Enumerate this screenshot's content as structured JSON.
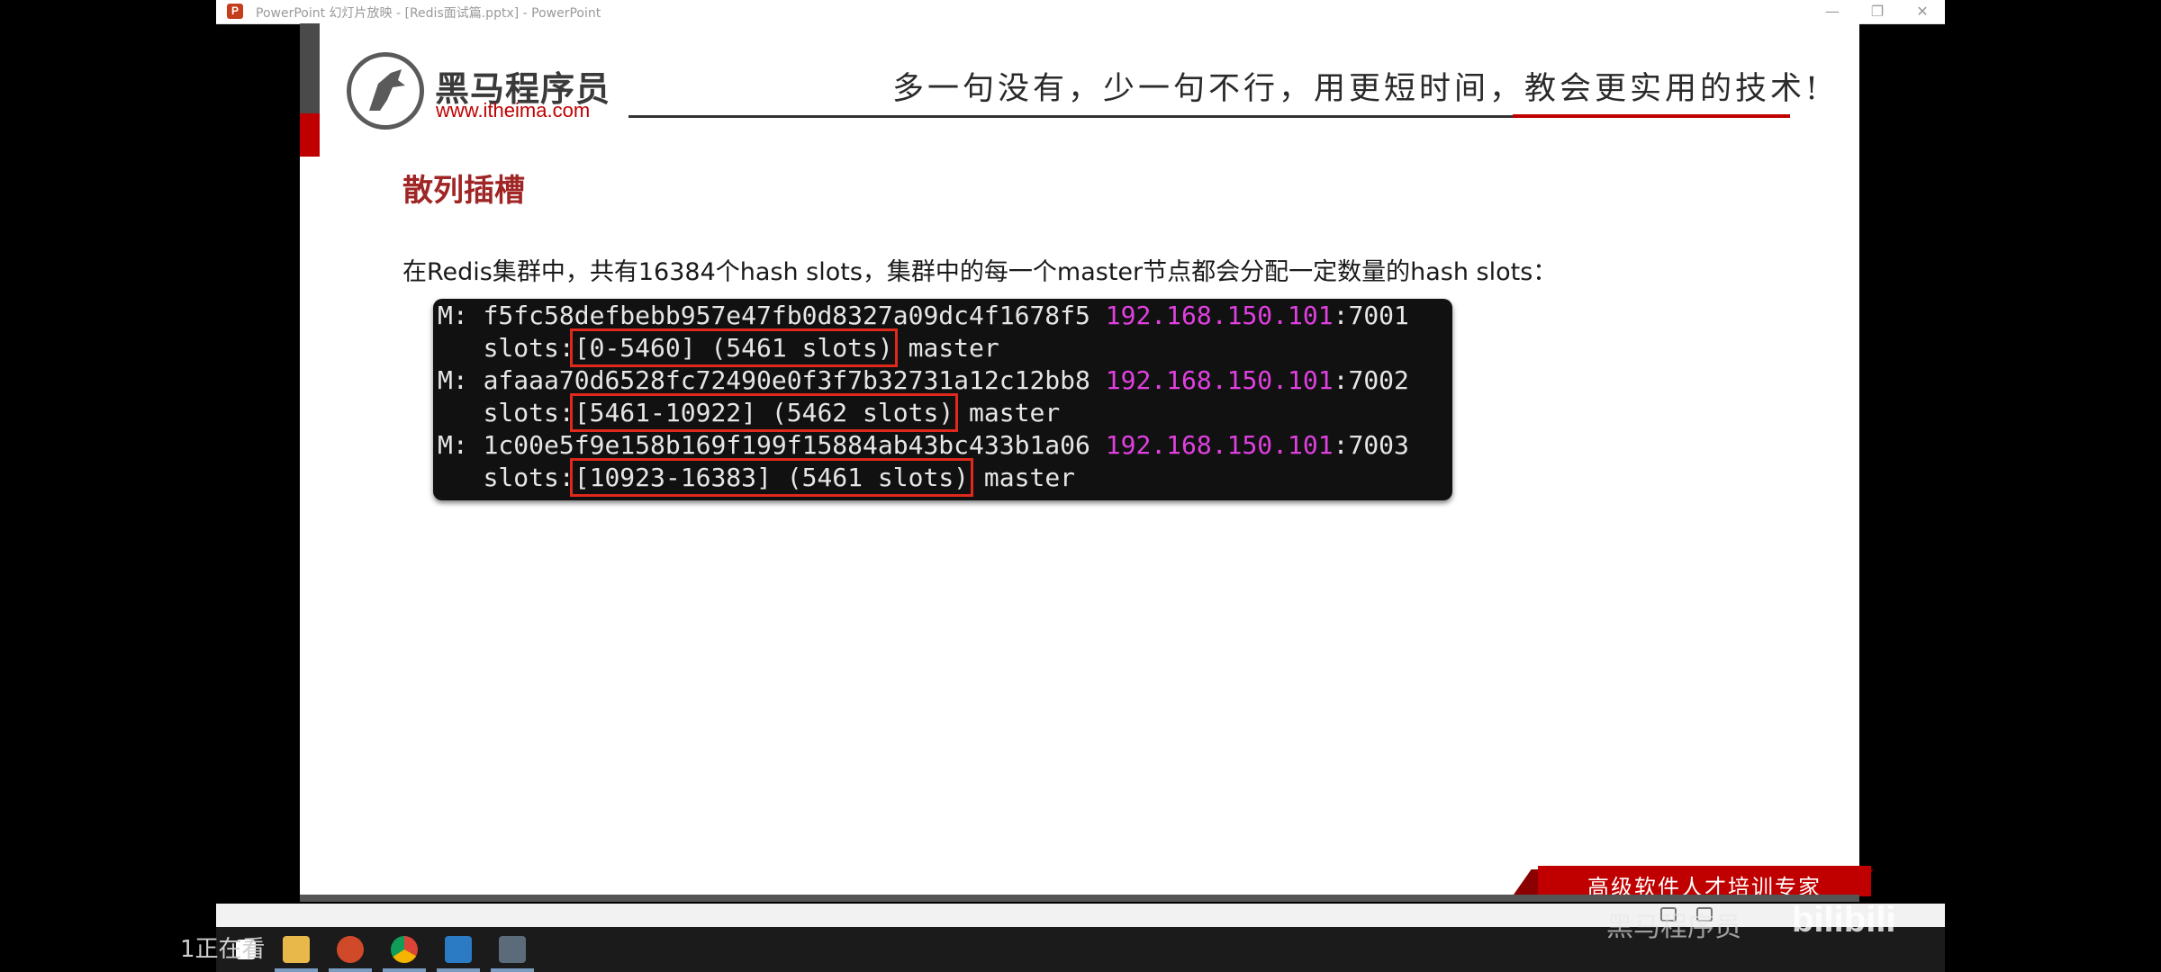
{
  "window": {
    "title": "PowerPoint 幻灯片放映 - [Redis面试篇.pptx] - PowerPoint",
    "app_icon": "P",
    "minimize_glyph": "—",
    "restore_glyph": "❐",
    "close_glyph": "✕"
  },
  "slide": {
    "logo_name": "黑马程序员",
    "logo_url": "www.itheima.com",
    "slogan": "多一句没有，少一句不行，用更短时间，教会更实用的技术!",
    "title": "散列插槽",
    "intro": "在Redis集群中，共有16384个hash slots，集群中的每一个master节点都会分配一定数量的hash slots：",
    "terminal": [
      {
        "prefix": "M: ",
        "node_id": "f5fc58defbebb957e47fb0d8327a09dc4f1678f5",
        "ip": "192.168.150.101",
        "port": ":7001",
        "slots_label": "slots:",
        "slots_range": "[0-5460] (5461 slots)",
        "role": "master"
      },
      {
        "prefix": "M: ",
        "node_id": "afaaa70d6528fc72490e0f3f7b32731a12c12bb8",
        "ip": "192.168.150.101",
        "port": ":7002",
        "slots_label": "slots:",
        "slots_range": "[5461-10922] (5462 slots)",
        "role": "master"
      },
      {
        "prefix": "M: ",
        "node_id": "1c00e5f9e158b169f199f15884ab43bc433b1a06",
        "ip": "192.168.150.101",
        "port": ":7003",
        "slots_label": "slots:",
        "slots_range": "[10923-16383] (5461 slots)",
        "role": "master"
      }
    ],
    "footer_ribbon": "高级软件人才培训专家"
  },
  "overlay": {
    "left_text": "1正在看",
    "watermark_text": "黑马程序员",
    "watermark_logo": "bilibili"
  },
  "colors": {
    "accent_red": "#c00000",
    "title_red": "#a02525",
    "ip_magenta": "#e040e0",
    "highlight_box": "#e0281c"
  },
  "taskbar": {
    "icons": [
      "windows-start-icon",
      "file-explorer-icon",
      "powerpoint-icon",
      "chrome-icon",
      "vscode-icon",
      "image-app-icon"
    ]
  }
}
